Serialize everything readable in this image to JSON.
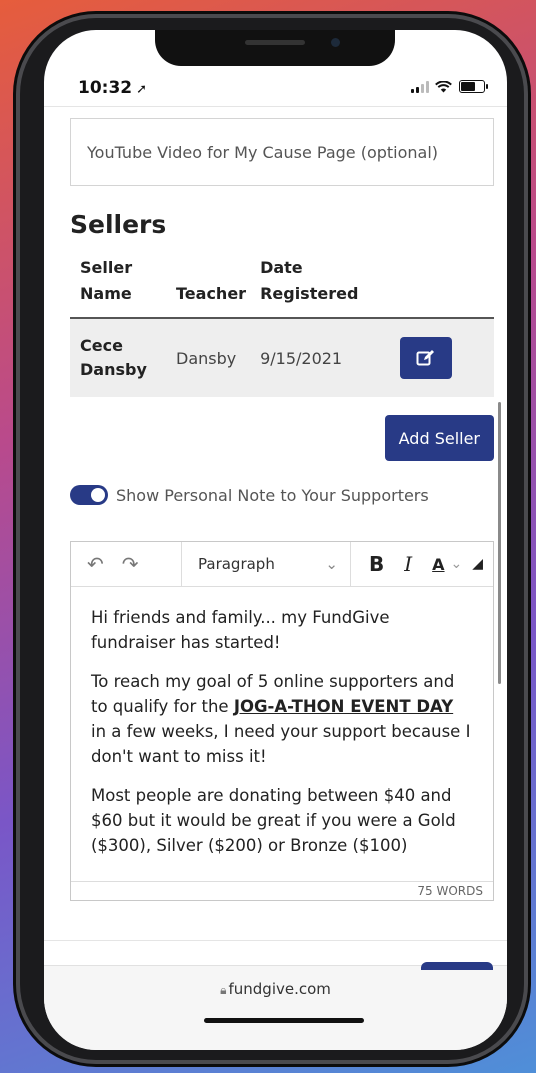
{
  "status_bar": {
    "time": "10:32",
    "location_icon": "location-arrow-icon",
    "signal_icon": "cellular-signal-icon",
    "wifi_icon": "wifi-icon",
    "battery_icon": "battery-icon"
  },
  "youtube_field": {
    "placeholder": "YouTube Video for My Cause Page (optional)"
  },
  "sellers": {
    "title": "Sellers",
    "headers": {
      "name_line1": "Seller",
      "name_line2": "Name",
      "teacher": "Teacher",
      "date_line1": "Date",
      "date_line2": "Registered"
    },
    "rows": [
      {
        "name_line1": "Cece",
        "name_line2": "Dansby",
        "teacher": "Dansby",
        "date": "9/15/2021",
        "edit_icon": "edit-icon"
      }
    ],
    "add_label": "Add Seller"
  },
  "personal_note": {
    "toggle_on": true,
    "label": "Show Personal Note to Your Supporters"
  },
  "editor": {
    "toolbar": {
      "undo_icon": "undo-icon",
      "redo_icon": "redo-icon",
      "block_format": "Paragraph",
      "bold": "B",
      "italic": "I",
      "text_color": "A"
    },
    "paragraphs": {
      "p1": "Hi friends and family... my FundGive fundraiser has started!",
      "p2_before": "To reach my goal of 5 online supporters and to qualify for the ",
      "p2_event": "JOG-A-THON EVENT DAY",
      "p2_after": " in a few weeks, I need your support because I don't want to miss it!",
      "p3": "Most people are donating between $40 and $60 but it would be great if you were a Gold ($300), Silver ($200) or Bronze ($100)"
    },
    "word_count": "75 WORDS"
  },
  "browser": {
    "url": "fundgive.com",
    "lock_icon": "lock-icon"
  },
  "colors": {
    "primary": "#283a86",
    "gradient_start": "#e65d3c",
    "gradient_end": "#4f8fd8"
  }
}
